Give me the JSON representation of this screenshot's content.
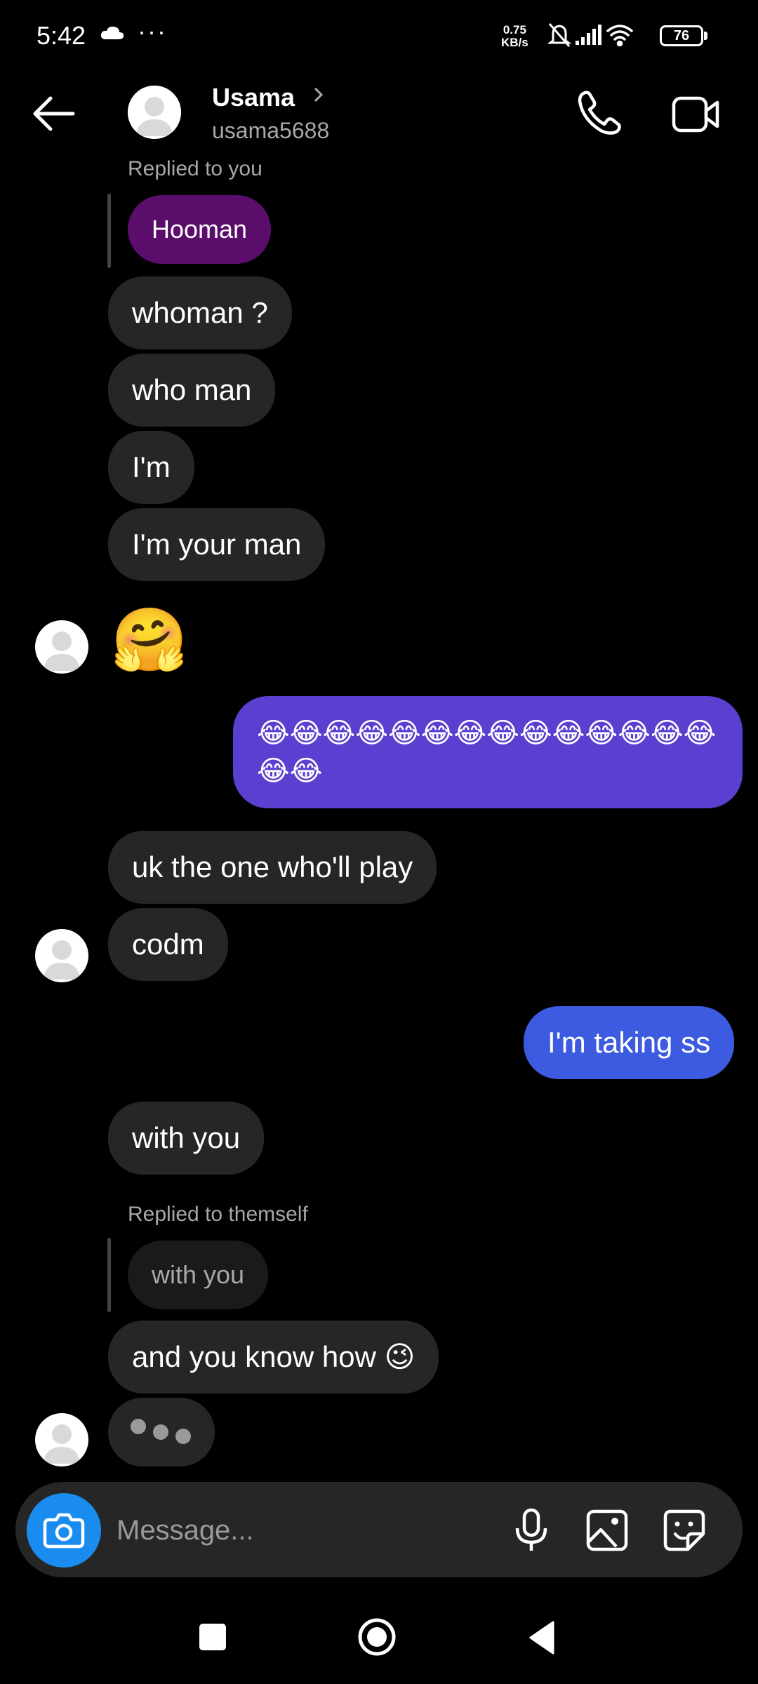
{
  "status_bar": {
    "time": "5:42",
    "more": "···",
    "net_speed_value": "0.75",
    "net_speed_unit": "KB/s",
    "battery": "76",
    "icons": [
      "cloud-icon",
      "silent-bell-icon",
      "signal-icon",
      "wifi-icon",
      "battery-icon"
    ]
  },
  "header": {
    "name": "Usama",
    "username": "usama5688",
    "icons": [
      "back-arrow-icon",
      "avatar-icon",
      "chevron-right-icon",
      "phone-icon",
      "video-icon"
    ]
  },
  "messages": [
    {
      "id": "m1",
      "sender": "them",
      "type": "reply",
      "reply_label": "Replied to you",
      "quoted": "Hooman"
    },
    {
      "id": "m2",
      "sender": "them",
      "text": "whoman ?"
    },
    {
      "id": "m3",
      "sender": "them",
      "text": "who man"
    },
    {
      "id": "m4",
      "sender": "them",
      "text": "I'm"
    },
    {
      "id": "m5",
      "sender": "them",
      "text": "I'm your man"
    },
    {
      "id": "m6",
      "sender": "them",
      "text": "🤗"
    },
    {
      "id": "m7",
      "sender": "me",
      "text": "😂😂😂😂😂😂😂😂😂😂😂😂😂😂😂😂"
    },
    {
      "id": "m8",
      "sender": "them",
      "text": "uk the one who'll play"
    },
    {
      "id": "m9",
      "sender": "them",
      "text": "codm"
    },
    {
      "id": "m10",
      "sender": "me",
      "text": "I'm taking ss"
    },
    {
      "id": "m11",
      "sender": "them",
      "text": "with you"
    },
    {
      "id": "m12",
      "sender": "them",
      "type": "reply",
      "reply_label": "Replied to themself",
      "quoted": "with you"
    },
    {
      "id": "m13",
      "sender": "them",
      "text": "and you know how 😉"
    },
    {
      "id": "m14",
      "sender": "them",
      "type": "typing"
    }
  ],
  "composer": {
    "placeholder": "Message...",
    "icons": [
      "camera-icon",
      "mic-icon",
      "gallery-icon",
      "sticker-icon"
    ]
  },
  "nav": {
    "icons": [
      "recents-square-icon",
      "home-circle-icon",
      "back-triangle-icon"
    ]
  },
  "colors": {
    "background": "#000000",
    "incoming_bubble": "#262626",
    "outgoing_purple": "#5b3fd0",
    "outgoing_blue": "#3d5be0",
    "reply_purple": "#5a0d6a",
    "camera_blue": "#1a8cf0",
    "muted_text": "#a8a8a8"
  }
}
